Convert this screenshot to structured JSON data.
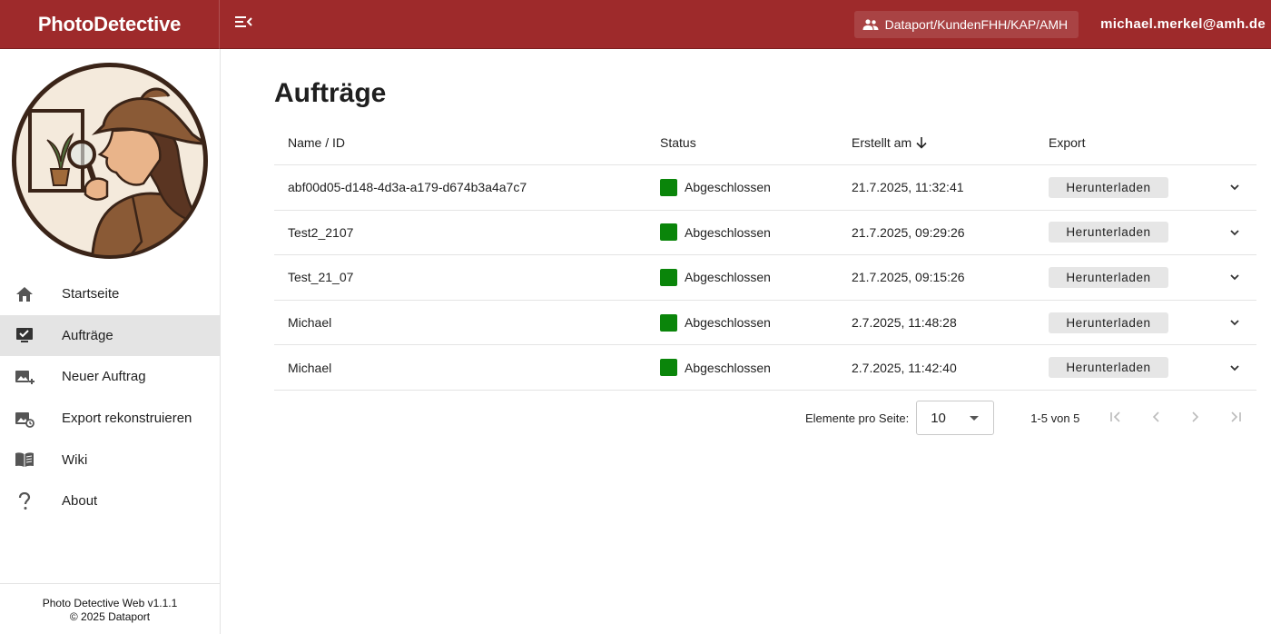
{
  "header": {
    "brand": "PhotoDetective",
    "tenant": "Dataport/KundenFHH/KAP/AMH",
    "user": "michael.merkel@amh.de",
    "icons": {
      "menu": "menu-collapse-icon",
      "tenant": "group-icon"
    }
  },
  "sidebar": {
    "items": [
      {
        "label": "Startseite",
        "icon": "home-icon",
        "active": false
      },
      {
        "label": "Aufträge",
        "icon": "orders-icon",
        "active": true
      },
      {
        "label": "Neuer Auftrag",
        "icon": "add-photo-icon",
        "active": false
      },
      {
        "label": "Export rekonstruieren",
        "icon": "photo-restore-icon",
        "active": false
      },
      {
        "label": "Wiki",
        "icon": "book-icon",
        "active": false
      },
      {
        "label": "About",
        "icon": "question-icon",
        "active": false
      }
    ],
    "footer": {
      "version": "Photo Detective Web v1.1.1",
      "copyright": "© 2025 Dataport"
    }
  },
  "main": {
    "title": "Aufträge",
    "columns": {
      "name": "Name / ID",
      "status": "Status",
      "created": "Erstellt am",
      "export": "Export"
    },
    "rows": [
      {
        "name": "abf00d05-d148-4d3a-a179-d674b3a4a7c7",
        "status": "Abgeschlossen",
        "created": "21.7.2025, 11:32:41",
        "export": "Herunterladen"
      },
      {
        "name": "Test2_2107",
        "status": "Abgeschlossen",
        "created": "21.7.2025, 09:29:26",
        "export": "Herunterladen"
      },
      {
        "name": "Test_21_07",
        "status": "Abgeschlossen",
        "created": "21.7.2025, 09:15:26",
        "export": "Herunterladen"
      },
      {
        "name": "Michael",
        "status": "Abgeschlossen",
        "created": "2.7.2025, 11:48:28",
        "export": "Herunterladen"
      },
      {
        "name": "Michael",
        "status": "Abgeschlossen",
        "created": "2.7.2025, 11:42:40",
        "export": "Herunterladen"
      }
    ],
    "status_color": "#0a850a",
    "paginator": {
      "label": "Elemente pro Seite:",
      "page_size": "10",
      "range": "1-5 von 5"
    }
  },
  "colors": {
    "brand": "#9e2a2b",
    "active_nav": "#e4e4e4"
  }
}
